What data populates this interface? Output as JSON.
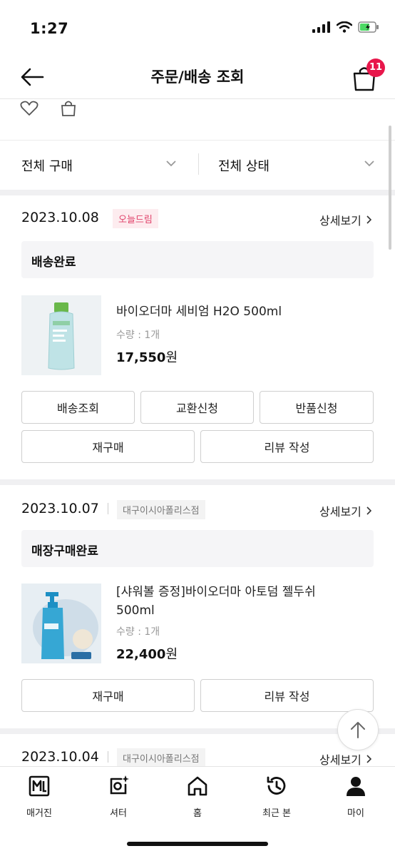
{
  "status_bar": {
    "time": "1:27"
  },
  "header": {
    "title": "주문/배송 조회",
    "cart_count": "11"
  },
  "filters": {
    "purchase": "전체 구매",
    "state": "전체 상태"
  },
  "orders": [
    {
      "date": "2023.10.08",
      "tag": "오늘드림",
      "detail": "상세보기",
      "status": "배송완료",
      "product": {
        "name": "바이오더마 세비엄 H2O 500ml",
        "qty": "수량 : 1개",
        "price": "17,550",
        "currency": "원"
      },
      "buttons": [
        "배송조회",
        "교환신청",
        "반품신청",
        "재구매",
        "리뷰 작성"
      ]
    },
    {
      "date": "2023.10.07",
      "tag": "대구이시아폴리스점",
      "detail": "상세보기",
      "status": "매장구매완료",
      "product": {
        "name_line1": "[샤워볼 증정]바이오더마 아토덤 젤두쉬",
        "name_line2": "500ml",
        "qty": "수량 : 1개",
        "price": "22,400",
        "currency": "원"
      },
      "buttons": [
        "재구매",
        "리뷰 작성"
      ]
    },
    {
      "date": "2023.10.04",
      "tag": "대구이시아폴리스점",
      "detail": "상세보기"
    }
  ],
  "tabs": [
    {
      "label": "매거진",
      "icon": "magazine-icon"
    },
    {
      "label": "셔터",
      "icon": "shutter-icon"
    },
    {
      "label": "홈",
      "icon": "home-icon"
    },
    {
      "label": "최근 본",
      "icon": "recent-icon"
    },
    {
      "label": "마이",
      "icon": "my-icon"
    }
  ],
  "colors": {
    "badge": "#e8174b",
    "tag_pink": "#e0436b"
  }
}
